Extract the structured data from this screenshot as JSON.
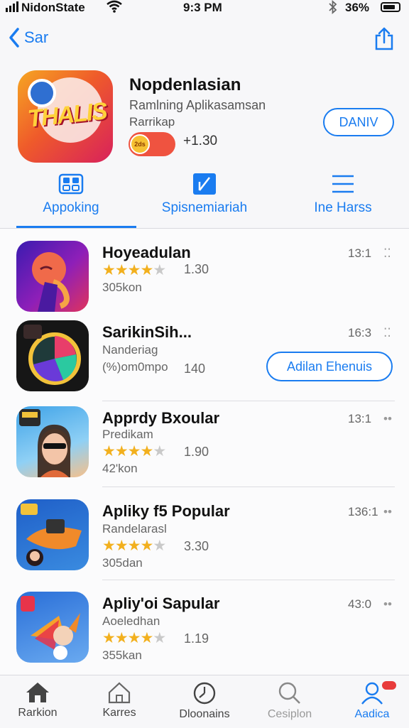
{
  "status_bar": {
    "carrier": "NidonState",
    "time": "9:3 PM",
    "battery": "36%"
  },
  "nav": {
    "back_label": "Sar"
  },
  "featured": {
    "title": "Nopdenlasian",
    "subtitle": "Ramlning Aplikasamsan",
    "subtitle2": "Rarrikap",
    "badge_text": "2ds",
    "price": "+1.30",
    "button_label": "DANIV",
    "icon_word": "THALIS"
  },
  "segments": [
    {
      "label": "Appoking",
      "icon": "grid-icon"
    },
    {
      "label": "Spisnemiariah",
      "icon": "bookmark-icon"
    },
    {
      "label": "Ine Harss",
      "icon": "list-icon"
    }
  ],
  "rows": [
    {
      "title": "Hoyeadulan",
      "rating_value": 4.5,
      "rating": "1.30",
      "size": "305kon",
      "time": "13:1"
    },
    {
      "title": "SarikinSih...",
      "line2": "Nanderiag",
      "line3": "(%)om0mpo",
      "rating": "140",
      "time": "16:3",
      "button_label": "Adilan Ehenuis"
    },
    {
      "title": "Apprdy Bxoular",
      "sub": "Predikam",
      "rating_value": 4.5,
      "rating": "1.90",
      "size": "42'kon",
      "time": "13:1"
    },
    {
      "title": "Apliky f5 Popular",
      "sub": "Randelarasl",
      "rating_value": 4,
      "rating": "3.30",
      "size": "305dan",
      "time": "136:1"
    },
    {
      "title": "Apliy'oi Sapular",
      "sub": "Aoeledhan",
      "rating_value": 4.5,
      "rating": "1.19",
      "size": "355kan",
      "time": "43:0"
    }
  ],
  "tabbar": [
    {
      "label": "Rarkion",
      "icon": "home-icon"
    },
    {
      "label": "Karres",
      "icon": "house-outline-icon"
    },
    {
      "label": "Dloonains",
      "icon": "clock-icon"
    },
    {
      "label": "Cesiplon",
      "icon": "search-icon"
    },
    {
      "label": "Aadica",
      "icon": "person-icon",
      "active": true
    }
  ],
  "colors": {
    "accent": "#1a7cf0",
    "star": "#f2b01e",
    "badge": "#e83b3b"
  }
}
